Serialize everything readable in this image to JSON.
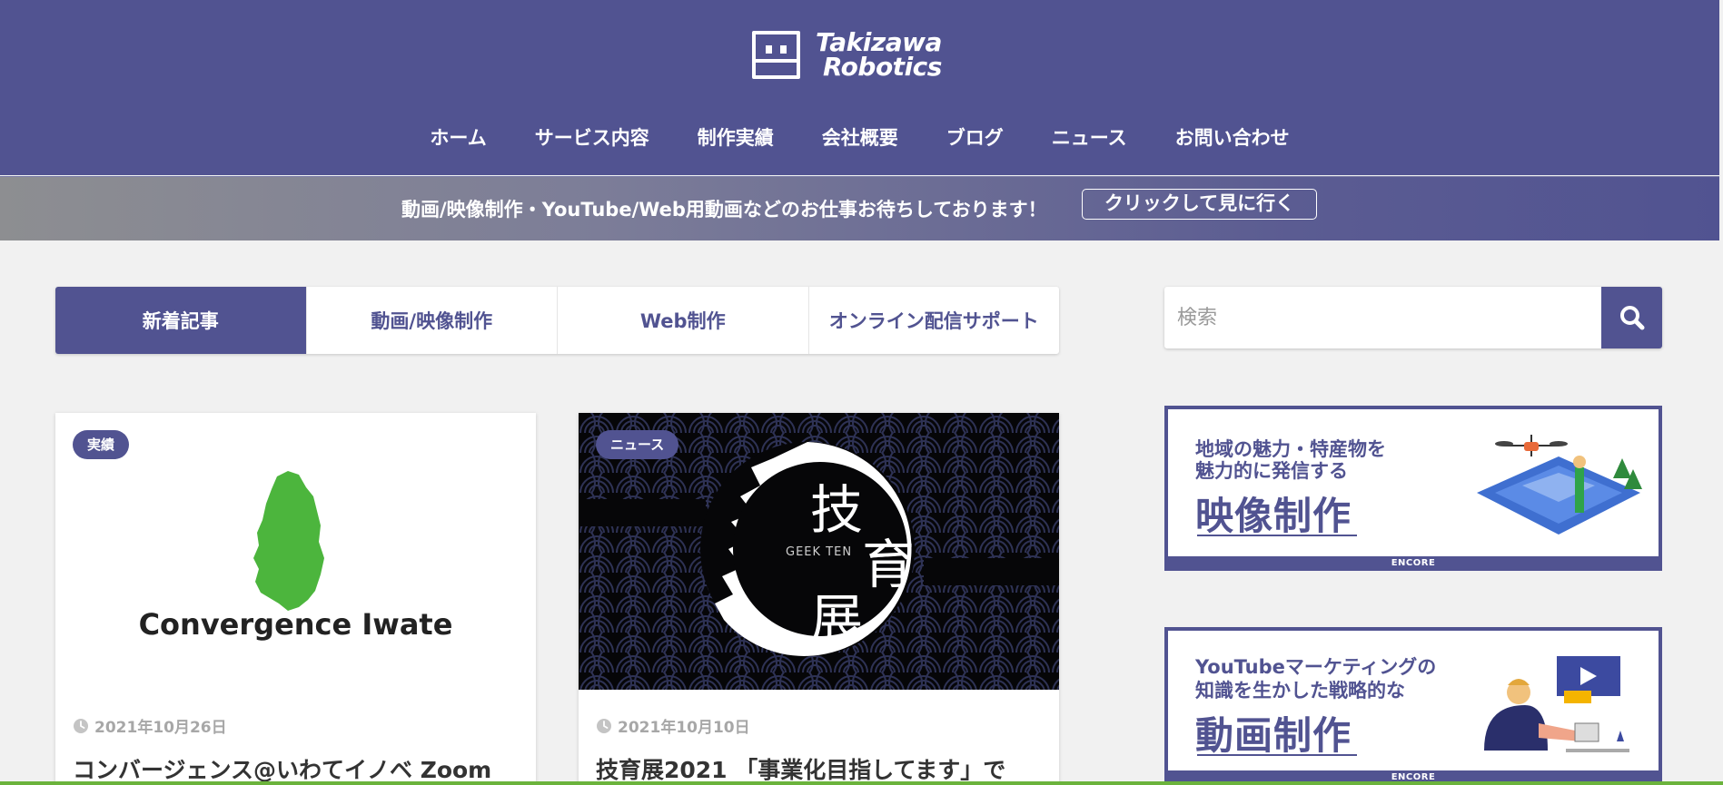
{
  "header": {
    "logo_line1": "Takizawa",
    "logo_line2": "Robotics",
    "nav": [
      "ホーム",
      "サービス内容",
      "制作実績",
      "会社概要",
      "ブログ",
      "ニュース",
      "お問い合わせ"
    ]
  },
  "promo": {
    "text": "動画/映像制作・YouTube/Web用動画などのお仕事お待ちしております！",
    "button": "クリックして見に行く"
  },
  "tabs": [
    {
      "label": "新着記事",
      "active": true
    },
    {
      "label": "動画/映像制作",
      "active": false
    },
    {
      "label": "Web制作",
      "active": false
    },
    {
      "label": "オンライン配信サポート",
      "active": false
    }
  ],
  "search": {
    "placeholder": "検索"
  },
  "cards": [
    {
      "badge": "実績",
      "thumb_text": "Convergence Iwate",
      "date": "2021年10月26日",
      "title": "コンバージェンス@いわてイノベ Zoom"
    },
    {
      "badge": "ニュース",
      "thumb_en": "GEEK TEN",
      "thumb_kanji": [
        "技",
        "育",
        "展"
      ],
      "date": "2021年10月10日",
      "title": "技育展2021 「事業化目指してます」で"
    }
  ],
  "banners": [
    {
      "line1": "地域の魅力・特産物を",
      "line2": "魅力的に発信する",
      "big": "映像制作",
      "foot": "ENCORE"
    },
    {
      "line1": "YouTubeマーケティングの",
      "line2": "知識を生かした戦略的な",
      "big": "動画制作",
      "foot": "ENCORE"
    }
  ],
  "colors": {
    "brand": "#515391",
    "accent_green": "#4cb53d",
    "background": "#f1f1f1"
  }
}
